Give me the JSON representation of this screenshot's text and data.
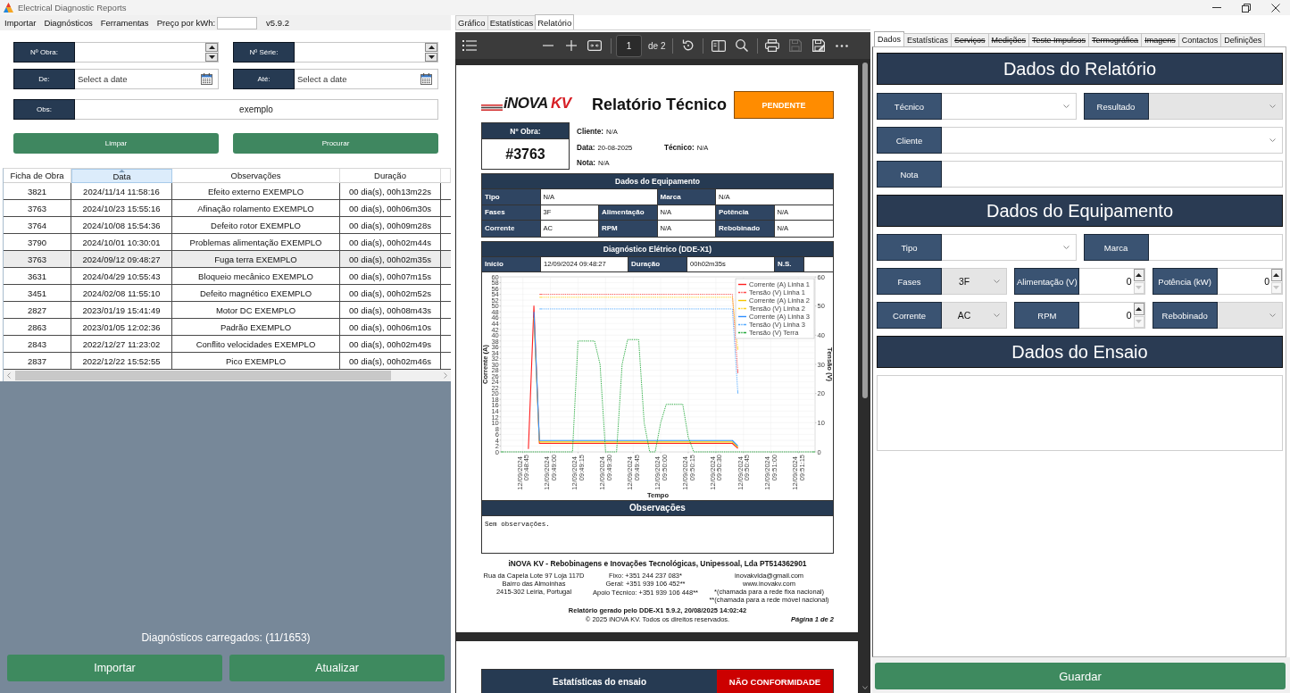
{
  "window": {
    "title": "Electrical Diagnostic Reports"
  },
  "menu": {
    "items": [
      "Importar",
      "Diagnósticos",
      "Ferramentas"
    ],
    "price_label": "Preço por kWh:",
    "version": "v5.9.2"
  },
  "filters": {
    "rows": [
      [
        {
          "kind": "spin",
          "label": "Nº Obra:"
        },
        {
          "kind": "spin",
          "label": "Nº Série:"
        }
      ],
      [
        {
          "kind": "date",
          "label": "De:",
          "placeholder": "Select a date"
        },
        {
          "kind": "date",
          "label": "Até:",
          "placeholder": "Select a date"
        }
      ],
      [
        {
          "kind": "text",
          "label": "Obs:",
          "value": "exemplo"
        }
      ]
    ],
    "buttons": [
      "Limpar",
      "Procurar"
    ]
  },
  "table": {
    "columns": [
      {
        "label": "Ficha de Obra",
        "sorted": false
      },
      {
        "label": "Data",
        "sorted": true
      },
      {
        "label": "Observações",
        "sorted": false
      },
      {
        "label": "Duração",
        "sorted": false
      }
    ],
    "rows": [
      {
        "cells": [
          "3821",
          "2024/11/14 11:58:16",
          "Efeito externo EXEMPLO",
          "00 dia(s), 00h13m22s"
        ],
        "selected": false
      },
      {
        "cells": [
          "3763",
          "2024/10/23 15:55:16",
          "Afinação rolamento EXEMPLO",
          "00 dia(s), 00h06m30s"
        ],
        "selected": false
      },
      {
        "cells": [
          "3764",
          "2024/10/08 15:54:36",
          "Defeito rotor EXEMPLO",
          "00 dia(s), 00h09m28s"
        ],
        "selected": false
      },
      {
        "cells": [
          "3790",
          "2024/10/01 10:30:01",
          "Problemas alimentação EXEMPLO",
          "00 dia(s), 00h02m44s"
        ],
        "selected": false
      },
      {
        "cells": [
          "3763",
          "2024/09/12 09:48:27",
          "Fuga terra EXEMPLO",
          "00 dia(s), 00h02m35s"
        ],
        "selected": true
      },
      {
        "cells": [
          "3631",
          "2024/04/29 10:55:43",
          "Bloqueio mecânico EXEMPLO",
          "00 dia(s), 00h07m15s"
        ],
        "selected": false
      },
      {
        "cells": [
          "3451",
          "2024/02/08 11:55:10",
          "Defeito magnético EXEMPLO",
          "00 dia(s), 00h02m52s"
        ],
        "selected": false
      },
      {
        "cells": [
          "2827",
          "2023/01/19 15:41:49",
          "Motor DC EXEMPLO",
          "00 dia(s), 00h08m43s"
        ],
        "selected": false
      },
      {
        "cells": [
          "2863",
          "2023/01/05 12:02:36",
          "Padrão EXEMPLO",
          "00 dia(s), 00h06m10s"
        ],
        "selected": false
      },
      {
        "cells": [
          "2843",
          "2022/12/27 11:23:02",
          "Conflito velocidades EXEMPLO",
          "00 dia(s), 00h02m49s"
        ],
        "selected": false
      },
      {
        "cells": [
          "2837",
          "2022/12/22 15:52:55",
          "Pico EXEMPLO",
          "00 dia(s), 00h02m46s"
        ],
        "selected": false
      }
    ]
  },
  "status": "Diagnósticos carregados: (11/1653)",
  "actions": [
    "Importar",
    "Atualizar"
  ],
  "viewer": {
    "tabs": [
      {
        "label": "Gráfico",
        "selected": false
      },
      {
        "label": "Estatísticas",
        "selected": false
      },
      {
        "label": "Relatório",
        "selected": true
      }
    ],
    "toolbar": {
      "page": "1",
      "page_count": "de 2",
      "save_disabled": true
    },
    "report": {
      "logo": {
        "name": "iNOVA",
        "accent": "KV"
      },
      "title": "Relatório Técnico",
      "status": {
        "kind": "pending",
        "label": "PENDENTE"
      },
      "job": {
        "label": "Nº Obra:",
        "value": "#3763"
      },
      "info": [
        [
          {
            "label": "Cliente:",
            "value": "N/A"
          }
        ],
        [
          {
            "label": "Data:",
            "value": "20-08-2025"
          },
          {
            "label": "Técnico:",
            "value": "N/A"
          }
        ],
        [
          {
            "label": "Nota:",
            "value": "N/A"
          }
        ]
      ],
      "equipment": {
        "title": "Dados do Equipamento",
        "rows": [
          [
            {
              "label": "Tipo",
              "value": "N/A"
            },
            {
              "label": "Marca",
              "value": "N/A"
            }
          ],
          [
            {
              "label": "Fases",
              "value": "3F"
            },
            {
              "label": "Alimentação",
              "value": "N/A"
            },
            {
              "label": "Potência",
              "value": "N/A"
            }
          ],
          [
            {
              "label": "Corrente",
              "value": "AC"
            },
            {
              "label": "RPM",
              "value": "N/A"
            },
            {
              "label": "Rebobinado",
              "value": "N/A"
            }
          ]
        ]
      },
      "diagnostic": {
        "title": "Diagnóstico Elétrico (DDE-X1)",
        "fields": [
          {
            "label": "Início",
            "value": "12/09/2024 09:48:27"
          },
          {
            "label": "Duração",
            "value": "00h02m35s"
          },
          {
            "label": "N.S."
          }
        ]
      },
      "chart_data": {
        "type": "line",
        "xlabel": "Tempo",
        "ylabel": "Corrente (A)",
        "grid": true,
        "legend": true,
        "categories": [
          null,
          null,
          null,
          null,
          "12/09/2024 09:48:45",
          null,
          null,
          null,
          null,
          "12/09/2024 09:49:00",
          null,
          null,
          null,
          null,
          "12/09/2024 09:49:15",
          null,
          null,
          null,
          null,
          "12/09/2024 09:49:30",
          null,
          null,
          null,
          null,
          "12/09/2024 09:49:45",
          null,
          null,
          null,
          null,
          "12/09/2024 09:50:00",
          null,
          null,
          null,
          null,
          "12/09/2024 09:50:15",
          null,
          null,
          null,
          null,
          "12/09/2024 09:50:30",
          null,
          null,
          null,
          null,
          "12/09/2024 09:50:45",
          null,
          null,
          null,
          null,
          "12/09/2024 09:51:00",
          null,
          null,
          null,
          null,
          "12/09/2024 09:51:15",
          null,
          null,
          null
        ],
        "ylim": [
          0,
          60
        ],
        "yticks": [
          0,
          2,
          4,
          6,
          8,
          10,
          12,
          14,
          16,
          18,
          20,
          22,
          24,
          26,
          28,
          30,
          32,
          34,
          36,
          38,
          40,
          42,
          44,
          46,
          48,
          50,
          52,
          54,
          56,
          58,
          60
        ],
        "series": [
          {
            "name": "Corrente (A) Linha 1",
            "color": "#ff1f1f",
            "line_style": "solid",
            "values": [
              null,
              null,
              null,
              null,
              null,
              1,
              50,
              2.9,
              2.9,
              2.9,
              2.9,
              2.9,
              2.9,
              2.9,
              2.9,
              2.9,
              2.9,
              2.9,
              2.9,
              2.9,
              2.9,
              2.9,
              2.9,
              2.9,
              2.9,
              2.9,
              2.9,
              2.9,
              2.9,
              2.9,
              2.9,
              2.9,
              2.9,
              2.9,
              2.9,
              2.9,
              2.9,
              2.9,
              2.9,
              2.9,
              2.9,
              2.9,
              2.9,
              1.2,
              null,
              null,
              null,
              null,
              null,
              null,
              null,
              null,
              null,
              null,
              null,
              null,
              null,
              null
            ]
          },
          {
            "name": "Tensão (V) Linha 1",
            "color": "#ff4d4d",
            "line_style": "dashed",
            "values": [
              null,
              null,
              null,
              null,
              null,
              null,
              null,
              54,
              54,
              54,
              54,
              54,
              54,
              54,
              54,
              54,
              54,
              54,
              54,
              54,
              54,
              54,
              54,
              54,
              54,
              54,
              54,
              54,
              54,
              54,
              54,
              54,
              54,
              54,
              54,
              54,
              54,
              54,
              54,
              54,
              54,
              54,
              54,
              27,
              null,
              null,
              null,
              null,
              null,
              null,
              null,
              null,
              null,
              null,
              null,
              null,
              null,
              null
            ]
          },
          {
            "name": "Corrente (A) Linha 2",
            "color": "#f5c400",
            "line_style": "solid",
            "values": [
              null,
              null,
              null,
              null,
              null,
              null,
              46,
              3.4,
              3.4,
              3.4,
              3.4,
              3.4,
              3.4,
              3.4,
              3.4,
              3.4,
              3.4,
              3.4,
              3.4,
              3.4,
              3.4,
              3.4,
              3.4,
              3.4,
              3.4,
              3.4,
              3.4,
              3.4,
              3.4,
              3.4,
              3.4,
              3.4,
              3.4,
              3.4,
              3.4,
              3.4,
              3.4,
              3.4,
              3.4,
              3.4,
              3.4,
              3.4,
              3.4,
              1.6,
              null,
              null,
              null,
              null,
              null,
              null,
              null,
              null,
              null,
              null,
              null,
              null,
              null,
              null
            ]
          },
          {
            "name": "Tensão (V) Linha 2",
            "color": "#ffd21f",
            "line_style": "dashed",
            "values": [
              null,
              null,
              null,
              null,
              null,
              null,
              null,
              53,
              53,
              53,
              53,
              53,
              53,
              53,
              53,
              53,
              53,
              53,
              53,
              53,
              53,
              53,
              53,
              53,
              53,
              53,
              53,
              53,
              53,
              53,
              53,
              53,
              53,
              53,
              53,
              53,
              53,
              53,
              53,
              53,
              53,
              53,
              53,
              35,
              null,
              null,
              null,
              null,
              null,
              null,
              null,
              null,
              null,
              null,
              null,
              null,
              null,
              null
            ]
          },
          {
            "name": "Corrente (A) Linha 3",
            "color": "#2f8fff",
            "line_style": "solid",
            "values": [
              null,
              null,
              null,
              null,
              null,
              null,
              48,
              3.9,
              3.9,
              3.9,
              3.9,
              3.9,
              3.9,
              3.9,
              3.9,
              3.9,
              3.9,
              3.9,
              3.9,
              3.9,
              3.9,
              3.9,
              3.9,
              3.9,
              3.9,
              3.9,
              3.9,
              3.9,
              3.9,
              3.9,
              3.9,
              3.9,
              3.9,
              3.9,
              3.9,
              3.9,
              3.9,
              3.9,
              3.9,
              3.9,
              3.9,
              3.9,
              3.9,
              2.0,
              null,
              null,
              null,
              null,
              null,
              null,
              null,
              null,
              null,
              null,
              null,
              null,
              null,
              null
            ]
          },
          {
            "name": "Tensão (V) Linha 3",
            "color": "#55aaff",
            "line_style": "dashed",
            "values": [
              null,
              null,
              null,
              null,
              null,
              null,
              null,
              49,
              49,
              49,
              49,
              49,
              49,
              49,
              49,
              49,
              49,
              49,
              49,
              49,
              49,
              49,
              49,
              49,
              49,
              49,
              49,
              49,
              49,
              49,
              49,
              49,
              49,
              49,
              49,
              49,
              49,
              49,
              49,
              49,
              49,
              49,
              49,
              20,
              null,
              null,
              null,
              null,
              null,
              null,
              null,
              null,
              null,
              null,
              null,
              null,
              null,
              null
            ]
          },
          {
            "name": "Tensão (V) Terra",
            "color": "#22a83a",
            "line_style": "dashed",
            "values": [
              0,
              0,
              0,
              0,
              0,
              0,
              0,
              0,
              0,
              0,
              0,
              0,
              0,
              0,
              38,
              38,
              38,
              38,
              30,
              0,
              0,
              0,
              30,
              38.5,
              38.5,
              38.5,
              10,
              0,
              0,
              10,
              16.3,
              16.3,
              16.3,
              16.3,
              5,
              0,
              0,
              0,
              0,
              0,
              0,
              0,
              0,
              0,
              0,
              0,
              0,
              0,
              0,
              0,
              0,
              0,
              0,
              0,
              0,
              0,
              0,
              0
            ]
          }
        ]
      },
      "chart_right_axis": {
        "title": "Tensão (V)",
        "ticks": [
          "60",
          "50",
          "40",
          "30",
          "20",
          "10",
          "0"
        ]
      },
      "observations": {
        "title": "Observações",
        "text": "Sem observações."
      },
      "footer": {
        "company": "iNOVA KV - Rebobinagens e Inovações Tecnológicas, Unipessoal, Lda PT514362901",
        "address": [
          "Rua da Capela Lote 97 Loja 117D",
          "Bairro das Almoinhas",
          "2415-302 Leiria, Portugal"
        ],
        "phones": [
          "Fixo: +351 244 237 083*",
          "Geral: +351 939 106 452**",
          "Apoio Técnico: +351 939 106 448**"
        ],
        "contacts": [
          "inovakvlda@gmail.com",
          "www.inovakv.com"
        ],
        "notes": [
          "*(chamada para a rede fixa nacional)",
          "**(chamada para a rede móvel nacional)"
        ],
        "generated": "Relatório gerado pelo DDE-X1 5.9.2, 20/08/2025 14:02:42",
        "copyright": "© 2025 iNOVA KV. Todos os direitos reservados.",
        "page": "Página 1 de 2"
      }
    },
    "next_page": {
      "title": "Estatísticas do ensaio",
      "status": {
        "kind": "fail",
        "label": "NÃO CONFORMIDADE"
      }
    }
  },
  "editor": {
    "tabs": [
      {
        "label": "Dados",
        "selected": true,
        "strikethrough": false
      },
      {
        "label": "Estatísticas",
        "selected": false,
        "strikethrough": false
      },
      {
        "label": "Serviços",
        "selected": false,
        "strikethrough": true
      },
      {
        "label": "Medições",
        "selected": false,
        "strikethrough": true
      },
      {
        "label": "Teste Impulsos",
        "selected": false,
        "strikethrough": true
      },
      {
        "label": "Termográfica",
        "selected": false,
        "strikethrough": true
      },
      {
        "label": "Imagens",
        "selected": false,
        "strikethrough": true
      },
      {
        "label": "Contactos",
        "selected": false,
        "strikethrough": false
      },
      {
        "label": "Definições",
        "selected": false,
        "strikethrough": false
      }
    ],
    "sections": [
      {
        "title": "Dados do Relatório",
        "rows": [
          [
            {
              "kind": "combo",
              "label": "Técnico",
              "editable": true
            },
            {
              "kind": "combo",
              "label": "Resultado",
              "editable": false
            }
          ],
          [
            {
              "kind": "combo",
              "label": "Cliente",
              "editable": true
            }
          ],
          [
            {
              "kind": "text",
              "label": "Nota"
            }
          ]
        ]
      },
      {
        "title": "Dados do Equipamento",
        "rows": [
          [
            {
              "kind": "combo",
              "label": "Tipo",
              "editable": true
            },
            {
              "kind": "text",
              "label": "Marca"
            }
          ],
          [
            {
              "kind": "combo",
              "label": "Fases",
              "editable": false,
              "value": "3F"
            },
            {
              "kind": "number",
              "label": "Alimentação (V)",
              "value": "0",
              "can_decrease": false
            },
            {
              "kind": "number",
              "label": "Potência (kW)",
              "value": "0",
              "can_decrease": false
            }
          ],
          [
            {
              "kind": "combo",
              "label": "Corrente",
              "editable": false,
              "value": "AC"
            },
            {
              "kind": "number",
              "label": "RPM",
              "value": "0",
              "can_decrease": false
            },
            {
              "kind": "combo",
              "label": "Rebobinado",
              "editable": false
            }
          ]
        ]
      },
      {
        "title": "Dados do Ensaio",
        "rows": [
          [
            {
              "kind": "textarea"
            }
          ]
        ]
      }
    ],
    "save": "Guardar"
  }
}
